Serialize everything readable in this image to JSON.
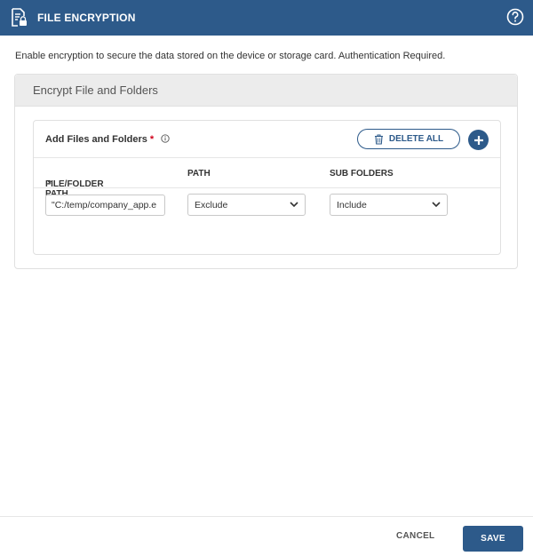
{
  "header": {
    "title": "FILE ENCRYPTION",
    "icon": "file-lock-icon",
    "help_icon": "help-circle-icon",
    "color": "#2d5a8a"
  },
  "description": "Enable encryption to secure the data stored on the device or storage card. Authentication Required.",
  "panel": {
    "title": "Encrypt File and Folders",
    "section": {
      "label": "Add Files and Folders",
      "required_marker": "*",
      "info_icon": "info-icon",
      "delete_all_label": "DELETE ALL",
      "add_icon": "plus-circle-icon"
    },
    "columns": [
      {
        "label": "FILE/FOLDER PATH",
        "required": "*"
      },
      {
        "label": "PATH"
      },
      {
        "label": "SUB FOLDERS"
      }
    ],
    "rows": [
      {
        "file_path": "\"C:/temp/company_app.e",
        "path": "Exclude",
        "sub_folders": "Include"
      }
    ]
  },
  "footer": {
    "cancel_label": "CANCEL",
    "save_label": "SAVE"
  }
}
